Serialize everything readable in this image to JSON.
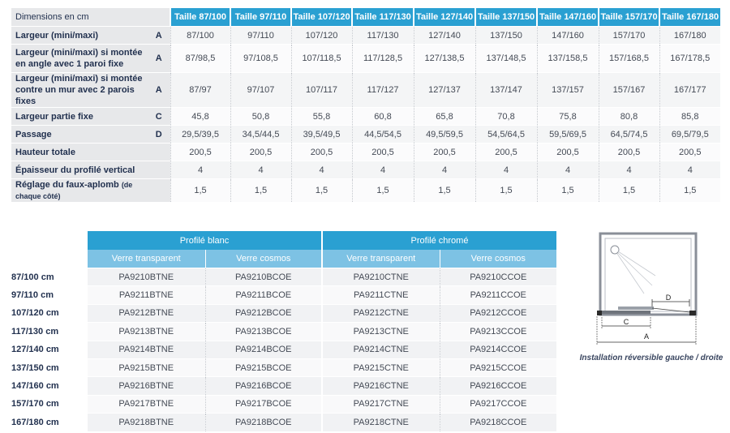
{
  "dimensions": {
    "corner_label": "Dimensions en cm",
    "sizes": [
      "Taille 87/100",
      "Taille 97/110",
      "Taille 107/120",
      "Taille 117/130",
      "Taille 127/140",
      "Taille 137/150",
      "Taille 147/160",
      "Taille 157/170",
      "Taille 167/180"
    ],
    "rows": [
      {
        "label": "Largeur (mini/maxi)",
        "label_line2": "",
        "note": "",
        "letter": "A",
        "values": [
          "87/100",
          "97/110",
          "107/120",
          "117/130",
          "127/140",
          "137/150",
          "147/160",
          "157/170",
          "167/180"
        ]
      },
      {
        "label": "Largeur (mini/maxi) si montée",
        "label_line2": "en angle avec 1 paroi fixe",
        "note": "",
        "letter": "A",
        "values": [
          "87/98,5",
          "97/108,5",
          "107/118,5",
          "117/128,5",
          "127/138,5",
          "137/148,5",
          "137/158,5",
          "157/168,5",
          "167/178,5"
        ]
      },
      {
        "label": "Largeur (mini/maxi) si montée",
        "label_line2": "contre un mur avec 2 parois fixes",
        "note": "",
        "letter": "A",
        "values": [
          "87/97",
          "97/107",
          "107/117",
          "117/127",
          "127/137",
          "137/147",
          "137/157",
          "157/167",
          "167/177"
        ]
      },
      {
        "label": "Largeur partie fixe",
        "label_line2": "",
        "note": "",
        "letter": "C",
        "values": [
          "45,8",
          "50,8",
          "55,8",
          "60,8",
          "65,8",
          "70,8",
          "75,8",
          "80,8",
          "85,8"
        ]
      },
      {
        "label": "Passage",
        "label_line2": "",
        "note": "",
        "letter": "D",
        "values": [
          "29,5/39,5",
          "34,5/44,5",
          "39,5/49,5",
          "44,5/54,5",
          "49,5/59,5",
          "54,5/64,5",
          "59,5/69,5",
          "64,5/74,5",
          "69,5/79,5"
        ]
      },
      {
        "label": "Hauteur totale",
        "label_line2": "",
        "note": "",
        "letter": "",
        "values": [
          "200,5",
          "200,5",
          "200,5",
          "200,5",
          "200,5",
          "200,5",
          "200,5",
          "200,5",
          "200,5"
        ]
      },
      {
        "label": "Épaisseur du profilé vertical",
        "label_line2": "",
        "note": "",
        "letter": "",
        "values": [
          "4",
          "4",
          "4",
          "4",
          "4",
          "4",
          "4",
          "4",
          "4"
        ]
      },
      {
        "label": "Réglage du faux-aplomb",
        "label_line2": "",
        "note": "(de chaque côté)",
        "letter": "",
        "values": [
          "1,5",
          "1,5",
          "1,5",
          "1,5",
          "1,5",
          "1,5",
          "1,5",
          "1,5",
          "1,5"
        ]
      }
    ]
  },
  "references": {
    "groups": [
      "Profilé blanc",
      "Profilé chromé"
    ],
    "subheaders": [
      "Verre transparent",
      "Verre cosmos",
      "Verre transparent",
      "Verre cosmos"
    ],
    "rows": [
      {
        "size": "87/100 cm",
        "codes": [
          "PA9210BTNE",
          "PA9210BCOE",
          "PA9210CTNE",
          "PA9210CCOE"
        ]
      },
      {
        "size": "97/110 cm",
        "codes": [
          "PA9211BTNE",
          "PA9211BCOE",
          "PA9211CTNE",
          "PA9211CCOE"
        ]
      },
      {
        "size": "107/120 cm",
        "codes": [
          "PA9212BTNE",
          "PA9212BCOE",
          "PA9212CTNE",
          "PA9212CCOE"
        ]
      },
      {
        "size": "117/130 cm",
        "codes": [
          "PA9213BTNE",
          "PA9213BCOE",
          "PA9213CTNE",
          "PA9213CCOE"
        ]
      },
      {
        "size": "127/140 cm",
        "codes": [
          "PA9214BTNE",
          "PA9214BCOE",
          "PA9214CTNE",
          "PA9214CCOE"
        ]
      },
      {
        "size": "137/150 cm",
        "codes": [
          "PA9215BTNE",
          "PA9215BCOE",
          "PA9215CTNE",
          "PA9215CCOE"
        ]
      },
      {
        "size": "147/160 cm",
        "codes": [
          "PA9216BTNE",
          "PA9216BCOE",
          "PA9216CTNE",
          "PA9216CCOE"
        ]
      },
      {
        "size": "157/170 cm",
        "codes": [
          "PA9217BTNE",
          "PA9217BCOE",
          "PA9217CTNE",
          "PA9217CCOE"
        ]
      },
      {
        "size": "167/180 cm",
        "codes": [
          "PA9218BTNE",
          "PA9218BCOE",
          "PA9218CTNE",
          "PA9218CCOE"
        ]
      }
    ]
  },
  "diagram": {
    "label_d": "D",
    "label_c": "C",
    "label_a": "A",
    "caption": "Installation réversible gauche / droite"
  }
}
